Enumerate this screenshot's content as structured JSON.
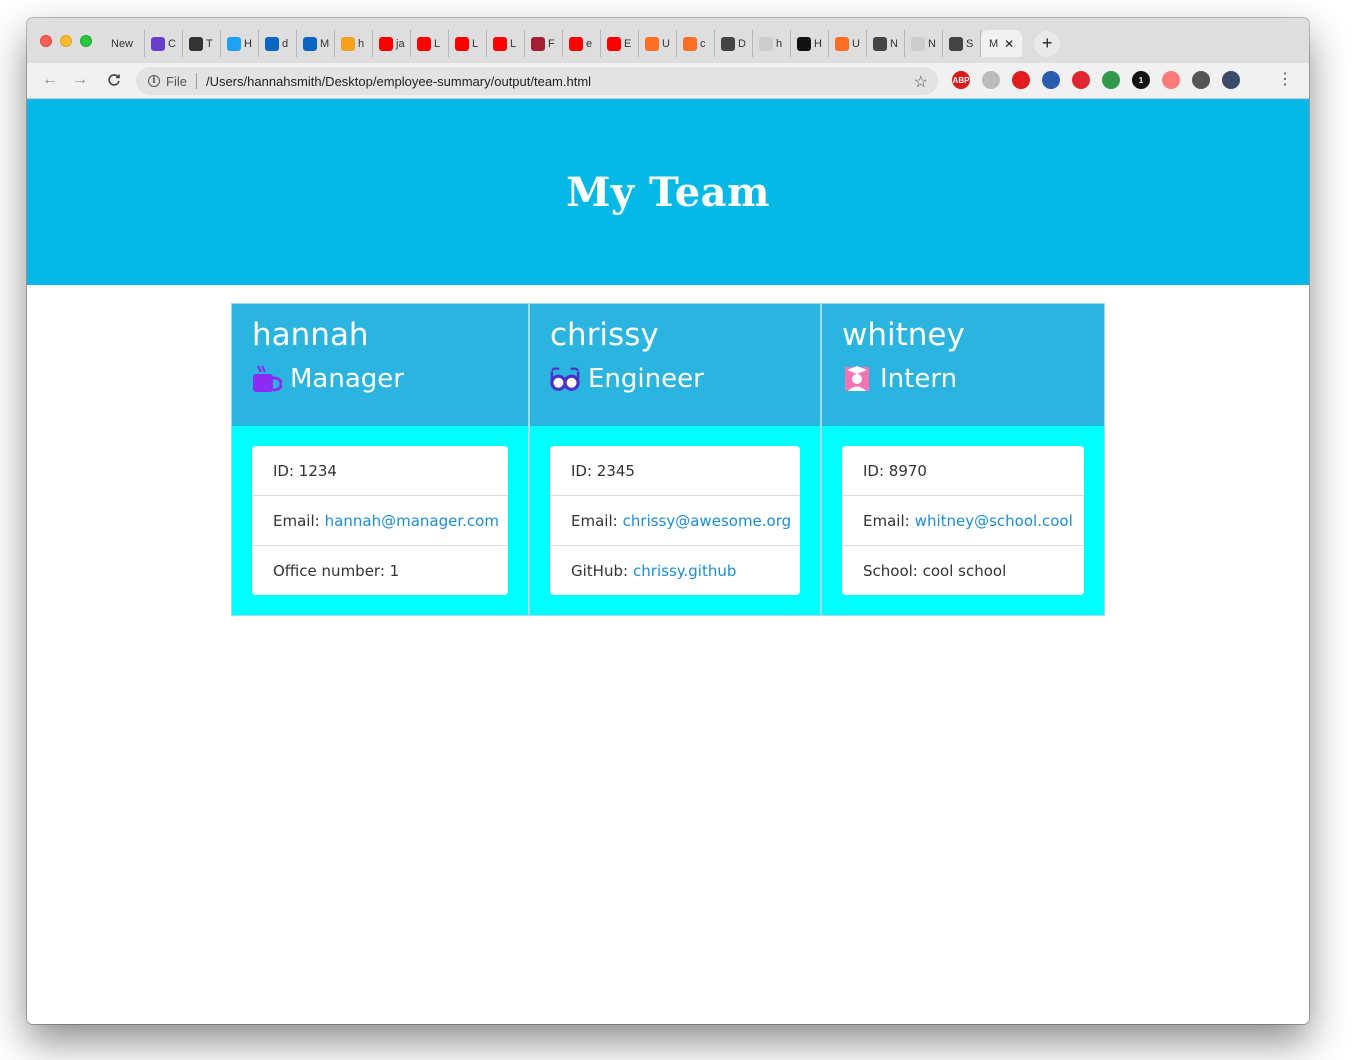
{
  "browser": {
    "tabs": [
      {
        "label": "New",
        "color": ""
      },
      {
        "label": "C",
        "color": "#6a3fc8"
      },
      {
        "label": "T",
        "color": "#333333"
      },
      {
        "label": "H",
        "color": "#1da1f2"
      },
      {
        "label": "d",
        "color": "#0a66c2"
      },
      {
        "label": "M",
        "color": "#0a66c2"
      },
      {
        "label": "h",
        "color": "#f7a21b"
      },
      {
        "label": "ja",
        "color": "#ff0000"
      },
      {
        "label": "L",
        "color": "#ff0000"
      },
      {
        "label": "L",
        "color": "#ff0000"
      },
      {
        "label": "L",
        "color": "#ff0000"
      },
      {
        "label": "F",
        "color": "#a31f34"
      },
      {
        "label": "e",
        "color": "#ff0000"
      },
      {
        "label": "E",
        "color": "#ff0000"
      },
      {
        "label": "U",
        "color": "#fc6d26"
      },
      {
        "label": "c",
        "color": "#fc6d26"
      },
      {
        "label": "D",
        "color": "#444444"
      },
      {
        "label": "h",
        "color": "#cccccc"
      },
      {
        "label": "H",
        "color": "#111111"
      },
      {
        "label": "U",
        "color": "#fc6d26"
      },
      {
        "label": "N",
        "color": "#444444"
      },
      {
        "label": "N",
        "color": "#cccccc"
      },
      {
        "label": "S",
        "color": "#444444"
      }
    ],
    "active_tab": {
      "label": "M",
      "close": "✕"
    },
    "new_tab": "+",
    "nav": {
      "back": "←",
      "forward": "→",
      "reload": "C"
    },
    "address": {
      "scheme": "File",
      "url": "/Users/hannahsmith/Desktop/employee-summary/output/team.html",
      "star": "☆"
    },
    "extensions": [
      {
        "name": "adblock-plus-icon",
        "label": "ABP",
        "color": "#d81b1b"
      },
      {
        "name": "ghostery-icon",
        "label": "",
        "color": "#bbbbbb"
      },
      {
        "name": "opera-icon",
        "label": "",
        "color": "#e11d1d"
      },
      {
        "name": "translate-icon",
        "label": "",
        "color": "#2a5db0"
      },
      {
        "name": "vivaldi-icon",
        "label": "",
        "color": "#e0262f"
      },
      {
        "name": "shield-icon",
        "label": "",
        "color": "#2e9a48"
      },
      {
        "name": "onepassword-icon",
        "label": "1",
        "color": "#111111"
      },
      {
        "name": "ext-arrow-icon",
        "label": "",
        "color": "#ff7a7a"
      },
      {
        "name": "puzzle-icon",
        "label": "",
        "color": "#555555"
      },
      {
        "name": "profile-avatar",
        "label": "",
        "color": "#3a4a6a"
      }
    ],
    "menu": "⋮"
  },
  "page": {
    "title": "My Team",
    "header_color": "#05b8e6",
    "card_head_color": "#2cb4e1",
    "card_body_color": "#00ffff",
    "link_color": "#1d8cd6"
  },
  "employees": [
    {
      "name": "hannah",
      "role": "Manager",
      "icon": "coffee-mug-icon",
      "id_text": "ID: 1234",
      "email_label": "Email:",
      "email": "hannah@manager.com",
      "extra_label": "Office number: 1",
      "extra_link": ""
    },
    {
      "name": "chrissy",
      "role": "Engineer",
      "icon": "glasses-icon",
      "id_text": "ID: 2345",
      "email_label": "Email:",
      "email": "chrissy@awesome.org",
      "extra_label": "GitHub:",
      "extra_link": "chrissy.github"
    },
    {
      "name": "whitney",
      "role": "Intern",
      "icon": "graduate-icon",
      "id_text": "ID: 8970",
      "email_label": "Email:",
      "email": "whitney@school.cool",
      "extra_label": "School: cool school",
      "extra_link": ""
    }
  ]
}
